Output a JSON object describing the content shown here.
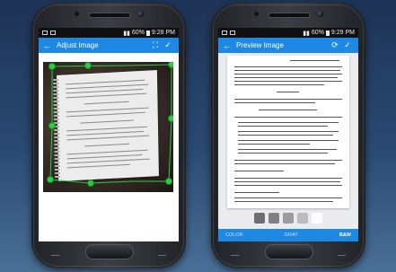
{
  "left_phone": {
    "status": {
      "time": "9:28 PM",
      "battery": "60%"
    },
    "title": "Adjust Image",
    "actions": {
      "back_icon": "arrow-back-icon",
      "crop_icon": "crop-fullscreen-icon",
      "done_icon": "check-icon"
    },
    "colors": {
      "appbar": "#1e88e5",
      "handle": "#2ecc40"
    }
  },
  "right_phone": {
    "status": {
      "time": "9:29 PM",
      "battery": "60%"
    },
    "title": "Preview Image",
    "actions": {
      "back_icon": "arrow-back-icon",
      "rotate_icon": "rotate-icon",
      "done_icon": "check-icon"
    },
    "swatches": [
      "#6d6f73",
      "#7f8185",
      "#9a9c9f",
      "#b9bbbe",
      "#ffffff"
    ],
    "filters": [
      "COLOR",
      "GRAY",
      "B&W"
    ],
    "active_filter": "B&W"
  }
}
